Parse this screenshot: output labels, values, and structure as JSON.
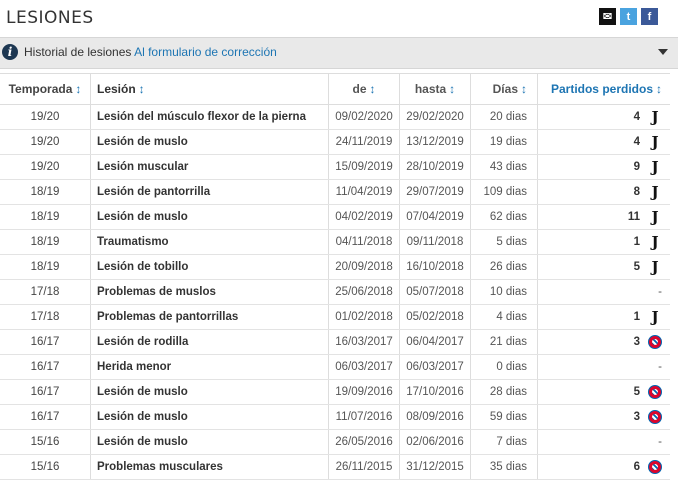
{
  "page": {
    "title": "LESIONES"
  },
  "share": {
    "mail": "✉",
    "twitter": "t",
    "facebook": "f"
  },
  "info_bar": {
    "text": "Historial de lesiones",
    "link": "Al formulario de corrección"
  },
  "table": {
    "headers": {
      "season": "Temporada",
      "injury": "Lesión",
      "from": "de",
      "until": "hasta",
      "days": "Días",
      "games": "Partidos perdidos",
      "sort_glyph": "↕"
    },
    "rows": [
      {
        "season": "19/20",
        "injury": "Lesión del músculo flexor de la pierna",
        "from": "09/02/2020",
        "until": "29/02/2020",
        "days": "20 dias",
        "games": "4",
        "club": "juventus"
      },
      {
        "season": "19/20",
        "injury": "Lesión de muslo",
        "from": "24/11/2019",
        "until": "13/12/2019",
        "days": "19 dias",
        "games": "4",
        "club": "juventus"
      },
      {
        "season": "19/20",
        "injury": "Lesión muscular",
        "from": "15/09/2019",
        "until": "28/10/2019",
        "days": "43 dias",
        "games": "9",
        "club": "juventus"
      },
      {
        "season": "18/19",
        "injury": "Lesión de pantorrilla",
        "from": "11/04/2019",
        "until": "29/07/2019",
        "days": "109 dias",
        "games": "8",
        "club": "juventus"
      },
      {
        "season": "18/19",
        "injury": "Lesión de muslo",
        "from": "04/02/2019",
        "until": "07/04/2019",
        "days": "62 dias",
        "games": "11",
        "club": "juventus"
      },
      {
        "season": "18/19",
        "injury": "Traumatismo",
        "from": "04/11/2018",
        "until": "09/11/2018",
        "days": "5 dias",
        "games": "1",
        "club": "juventus"
      },
      {
        "season": "18/19",
        "injury": "Lesión de tobillo",
        "from": "20/09/2018",
        "until": "16/10/2018",
        "days": "26 dias",
        "games": "5",
        "club": "juventus"
      },
      {
        "season": "17/18",
        "injury": "Problemas de muslos",
        "from": "25/06/2018",
        "until": "05/07/2018",
        "days": "10 dias",
        "games": "-",
        "club": ""
      },
      {
        "season": "17/18",
        "injury": "Problemas de pantorrillas",
        "from": "01/02/2018",
        "until": "05/02/2018",
        "days": "4 dias",
        "games": "1",
        "club": "juventus"
      },
      {
        "season": "16/17",
        "injury": "Lesión de rodilla",
        "from": "16/03/2017",
        "until": "06/04/2017",
        "days": "21 dias",
        "games": "3",
        "club": "bayern"
      },
      {
        "season": "16/17",
        "injury": "Herida menor",
        "from": "06/03/2017",
        "until": "06/03/2017",
        "days": "0 dias",
        "games": "-",
        "club": ""
      },
      {
        "season": "16/17",
        "injury": "Lesión de muslo",
        "from": "19/09/2016",
        "until": "17/10/2016",
        "days": "28 dias",
        "games": "5",
        "club": "bayern"
      },
      {
        "season": "16/17",
        "injury": "Lesión de muslo",
        "from": "11/07/2016",
        "until": "08/09/2016",
        "days": "59 dias",
        "games": "3",
        "club": "bayern"
      },
      {
        "season": "15/16",
        "injury": "Lesión de muslo",
        "from": "26/05/2016",
        "until": "02/06/2016",
        "days": "7 dias",
        "games": "-",
        "club": ""
      },
      {
        "season": "15/16",
        "injury": "Problemas musculares",
        "from": "26/11/2015",
        "until": "31/12/2015",
        "days": "35 dias",
        "games": "6",
        "club": "bayern"
      }
    ],
    "club_logo_glyphs": {
      "juventus": "J",
      "bayern": ""
    }
  },
  "colors": {
    "accent": "#1d75b3",
    "bar_bg": "#e9e9e9",
    "info_icon": "#1d3752"
  }
}
